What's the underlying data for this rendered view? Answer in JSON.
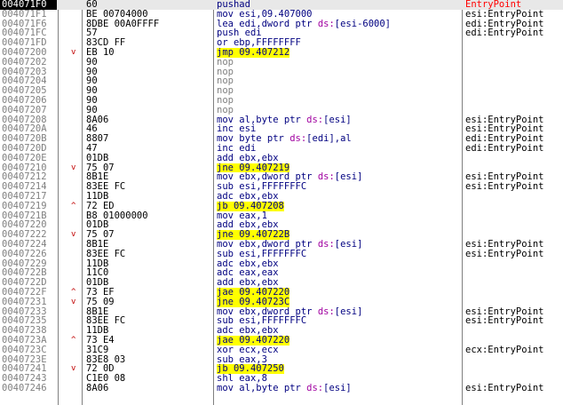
{
  "selected_address": "004071F0",
  "colors": {
    "address": "#808080",
    "selected_address_bg": "#000000",
    "jump_highlight": "#ffff00",
    "arrow": "#c00000",
    "mnemonic": "#000080",
    "nop": "#808080",
    "segment": "#a000a0",
    "entrypoint_comment": "#ff0000"
  },
  "rows": [
    {
      "addr": "004071F0",
      "arrow": "",
      "bytes": "60",
      "instr": "pushad",
      "comment": "EntryPoint"
    },
    {
      "addr": "004071F1",
      "arrow": "",
      "bytes": "BE 00704000",
      "instr": "mov esi,09.407000",
      "comment": "esi:EntryPoint"
    },
    {
      "addr": "004071F6",
      "arrow": "",
      "bytes": "8DBE 00A0FFFF",
      "instr": "lea edi,dword ptr ds:[esi-6000]",
      "comment": "edi:EntryPoint"
    },
    {
      "addr": "004071FC",
      "arrow": "",
      "bytes": "57",
      "instr": "push edi",
      "comment": "edi:EntryPoint"
    },
    {
      "addr": "004071FD",
      "arrow": "",
      "bytes": "83CD FF",
      "instr": "or ebp,FFFFFFFF",
      "comment": ""
    },
    {
      "addr": "00407200",
      "arrow": "v",
      "bytes": "EB 10",
      "instr": "jmp 09.407212",
      "comment": ""
    },
    {
      "addr": "00407202",
      "arrow": "",
      "bytes": "90",
      "instr": "nop",
      "comment": ""
    },
    {
      "addr": "00407203",
      "arrow": "",
      "bytes": "90",
      "instr": "nop",
      "comment": ""
    },
    {
      "addr": "00407204",
      "arrow": "",
      "bytes": "90",
      "instr": "nop",
      "comment": ""
    },
    {
      "addr": "00407205",
      "arrow": "",
      "bytes": "90",
      "instr": "nop",
      "comment": ""
    },
    {
      "addr": "00407206",
      "arrow": "",
      "bytes": "90",
      "instr": "nop",
      "comment": ""
    },
    {
      "addr": "00407207",
      "arrow": "",
      "bytes": "90",
      "instr": "nop",
      "comment": ""
    },
    {
      "addr": "00407208",
      "arrow": "",
      "bytes": "8A06",
      "instr": "mov al,byte ptr ds:[esi]",
      "comment": "esi:EntryPoint"
    },
    {
      "addr": "0040720A",
      "arrow": "",
      "bytes": "46",
      "instr": "inc esi",
      "comment": "esi:EntryPoint"
    },
    {
      "addr": "0040720B",
      "arrow": "",
      "bytes": "8807",
      "instr": "mov byte ptr ds:[edi],al",
      "comment": "edi:EntryPoint"
    },
    {
      "addr": "0040720D",
      "arrow": "",
      "bytes": "47",
      "instr": "inc edi",
      "comment": "edi:EntryPoint"
    },
    {
      "addr": "0040720E",
      "arrow": "",
      "bytes": "01DB",
      "instr": "add ebx,ebx",
      "comment": ""
    },
    {
      "addr": "00407210",
      "arrow": "v",
      "bytes": "75 07",
      "instr": "jne 09.407219",
      "comment": ""
    },
    {
      "addr": "00407212",
      "arrow": "",
      "bytes": "8B1E",
      "instr": "mov ebx,dword ptr ds:[esi]",
      "comment": "esi:EntryPoint"
    },
    {
      "addr": "00407214",
      "arrow": "",
      "bytes": "83EE FC",
      "instr": "sub esi,FFFFFFFC",
      "comment": "esi:EntryPoint"
    },
    {
      "addr": "00407217",
      "arrow": "",
      "bytes": "11DB",
      "instr": "adc ebx,ebx",
      "comment": ""
    },
    {
      "addr": "00407219",
      "arrow": "^",
      "bytes": "72 ED",
      "instr": "jb 09.407208",
      "comment": ""
    },
    {
      "addr": "0040721B",
      "arrow": "",
      "bytes": "B8 01000000",
      "instr": "mov eax,1",
      "comment": ""
    },
    {
      "addr": "00407220",
      "arrow": "",
      "bytes": "01DB",
      "instr": "add ebx,ebx",
      "comment": ""
    },
    {
      "addr": "00407222",
      "arrow": "v",
      "bytes": "75 07",
      "instr": "jne 09.40722B",
      "comment": ""
    },
    {
      "addr": "00407224",
      "arrow": "",
      "bytes": "8B1E",
      "instr": "mov ebx,dword ptr ds:[esi]",
      "comment": "esi:EntryPoint"
    },
    {
      "addr": "00407226",
      "arrow": "",
      "bytes": "83EE FC",
      "instr": "sub esi,FFFFFFFC",
      "comment": "esi:EntryPoint"
    },
    {
      "addr": "00407229",
      "arrow": "",
      "bytes": "11DB",
      "instr": "adc ebx,ebx",
      "comment": ""
    },
    {
      "addr": "0040722B",
      "arrow": "",
      "bytes": "11C0",
      "instr": "adc eax,eax",
      "comment": ""
    },
    {
      "addr": "0040722D",
      "arrow": "",
      "bytes": "01DB",
      "instr": "add ebx,ebx",
      "comment": ""
    },
    {
      "addr": "0040722F",
      "arrow": "^",
      "bytes": "73 EF",
      "instr": "jae 09.407220",
      "comment": ""
    },
    {
      "addr": "00407231",
      "arrow": "v",
      "bytes": "75 09",
      "instr": "jne 09.40723C",
      "comment": ""
    },
    {
      "addr": "00407233",
      "arrow": "",
      "bytes": "8B1E",
      "instr": "mov ebx,dword ptr ds:[esi]",
      "comment": "esi:EntryPoint"
    },
    {
      "addr": "00407235",
      "arrow": "",
      "bytes": "83EE FC",
      "instr": "sub esi,FFFFFFFC",
      "comment": "esi:EntryPoint"
    },
    {
      "addr": "00407238",
      "arrow": "",
      "bytes": "11DB",
      "instr": "adc ebx,ebx",
      "comment": ""
    },
    {
      "addr": "0040723A",
      "arrow": "^",
      "bytes": "73 E4",
      "instr": "jae 09.407220",
      "comment": ""
    },
    {
      "addr": "0040723C",
      "arrow": "",
      "bytes": "31C9",
      "instr": "xor ecx,ecx",
      "comment": "ecx:EntryPoint"
    },
    {
      "addr": "0040723E",
      "arrow": "",
      "bytes": "83E8 03",
      "instr": "sub eax,3",
      "comment": ""
    },
    {
      "addr": "00407241",
      "arrow": "v",
      "bytes": "72 0D",
      "instr": "jb 09.407250",
      "comment": ""
    },
    {
      "addr": "00407243",
      "arrow": "",
      "bytes": "C1E0 08",
      "instr": "shl eax,8",
      "comment": ""
    },
    {
      "addr": "00407246",
      "arrow": "",
      "bytes": "8A06",
      "instr": "mov al,byte ptr ds:[esi]",
      "comment": "esi:EntryPoint"
    }
  ]
}
